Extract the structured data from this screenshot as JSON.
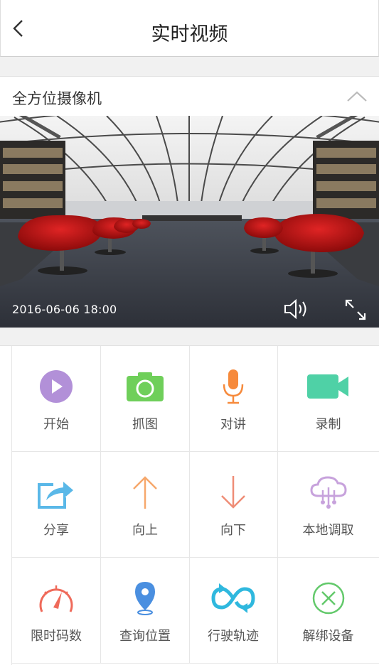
{
  "header": {
    "title": "实时视频",
    "back_icon": "chevron-left-icon"
  },
  "camera_section": {
    "title": "全方位摄像机",
    "toggle_icon": "chevron-up-icon"
  },
  "video": {
    "timestamp": "2016-06-06  18:00",
    "volume_icon": "speaker-icon",
    "fullscreen_icon": "expand-icon"
  },
  "actions": [
    {
      "label": "开始",
      "icon": "play-icon",
      "color": "#b290d8"
    },
    {
      "label": "抓图",
      "icon": "camera-icon",
      "color": "#6fcf5a"
    },
    {
      "label": "对讲",
      "icon": "microphone-icon",
      "color": "#f68a3c"
    },
    {
      "label": "录制",
      "icon": "video-camera-icon",
      "color": "#4fd1a6"
    },
    {
      "label": "分享",
      "icon": "share-icon",
      "color": "#5ab8e8"
    },
    {
      "label": "向上",
      "icon": "arrow-up-icon",
      "color": "#f6a86c"
    },
    {
      "label": "向下",
      "icon": "arrow-down-icon",
      "color": "#ef8d76"
    },
    {
      "label": "本地调取",
      "icon": "cloud-icon",
      "color": "#c7a2dc"
    },
    {
      "label": "限时码数",
      "icon": "speedometer-icon",
      "color": "#ef6a5a"
    },
    {
      "label": "查询位置",
      "icon": "location-pin-icon",
      "color": "#4a8fe0"
    },
    {
      "label": "行驶轨迹",
      "icon": "loop-icon",
      "color": "#2fb8de"
    },
    {
      "label": "解绑设备",
      "icon": "unbind-icon",
      "color": "#63c96b"
    }
  ]
}
